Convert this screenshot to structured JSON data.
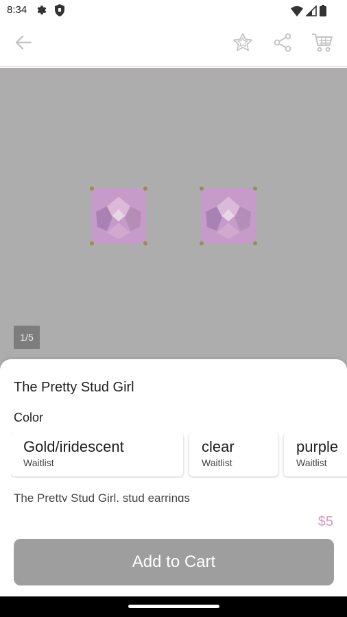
{
  "status_bar": {
    "time": "8:34",
    "icons": [
      "gear-icon",
      "shield-icon",
      "wifi-icon",
      "signal-icon",
      "battery-icon"
    ]
  },
  "app_bar": {
    "icons": [
      "back-arrow-icon",
      "star-icon",
      "share-icon",
      "cart-icon"
    ]
  },
  "gallery": {
    "counter": "1/5",
    "colors": {
      "background": "#adadad",
      "gem": "#c79bc9",
      "gem_highlight": "#e6d8e3"
    }
  },
  "product": {
    "title": "The Pretty Stud Girl",
    "color_label": "Color",
    "options": [
      {
        "name": "Gold/iridescent",
        "status": "Waitlist"
      },
      {
        "name": "clear",
        "status": "Waitlist"
      },
      {
        "name": "purple",
        "status": "Waitlist"
      }
    ],
    "description": "The Pretty Stud Girl, stud earrings",
    "price": "$5",
    "add_to_cart_label": "Add to Cart"
  },
  "colors": {
    "accent_pink": "#d59ac3",
    "app_bar_border": "#e7bcd6",
    "button_gray": "#9e9e9e"
  }
}
